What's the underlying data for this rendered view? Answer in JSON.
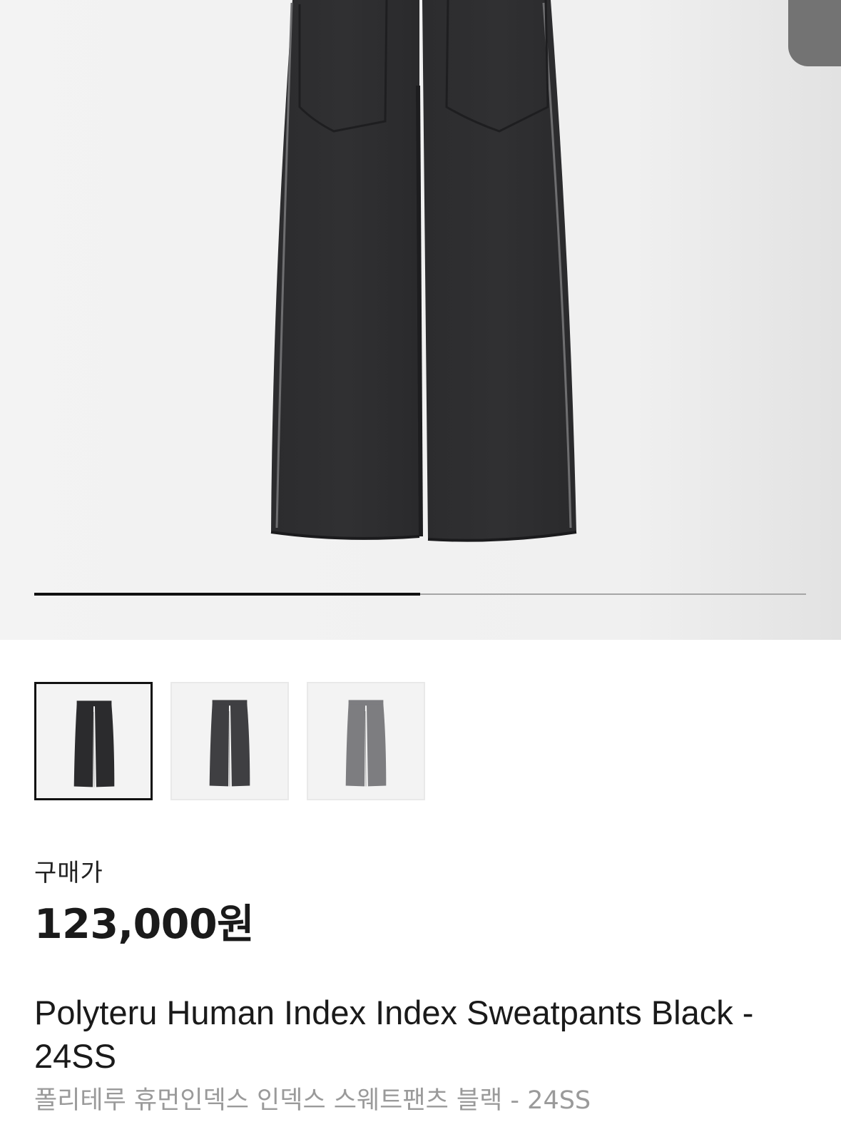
{
  "gallery": {
    "main_image": "black-sweatpants-photo",
    "slide_progress": 0.5,
    "thumbnails": [
      {
        "name": "black-sweatpants",
        "selected": true,
        "color": "#2b2b2d"
      },
      {
        "name": "charcoal-sweatpants",
        "selected": false,
        "color": "#3f3f42"
      },
      {
        "name": "gray-sweatpants",
        "selected": false,
        "color": "#7d7d80"
      }
    ]
  },
  "product": {
    "price_label": "구매가",
    "price": "123,000원",
    "title": "Polyteru Human Index Index Sweatpants Black - 24SS",
    "subtitle": "폴리테루 휴먼인덱스 인덱스 스웨트팬츠 블랙 - 24SS"
  },
  "colors": {
    "accent": "#111111",
    "muted_text": "#9a9a9a"
  }
}
